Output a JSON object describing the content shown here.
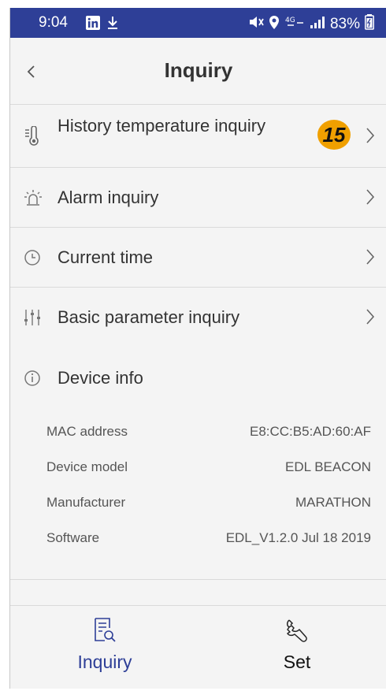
{
  "status_bar": {
    "time": "9:04",
    "battery": "83%",
    "network_tag": "4G",
    "background_color": "#2e3f97"
  },
  "header": {
    "title": "Inquiry",
    "back_icon": "chevron-left-icon"
  },
  "menu": {
    "items": [
      {
        "icon": "thermometer-icon",
        "label": "History temperature inquiry",
        "badge": "15"
      },
      {
        "icon": "alarm-icon",
        "label": "Alarm inquiry"
      },
      {
        "icon": "clock-icon",
        "label": "Current time"
      },
      {
        "icon": "sliders-icon",
        "label": "Basic parameter inquiry"
      }
    ]
  },
  "device_info": {
    "icon": "info-icon",
    "title": "Device info",
    "rows": [
      {
        "key": "MAC address",
        "value": "E8:CC:B5:AD:60:AF"
      },
      {
        "key": "Device model",
        "value": "EDL BEACON"
      },
      {
        "key": "Manufacturer",
        "value": "MARATHON"
      },
      {
        "key": "Software",
        "value": "EDL_V1.2.0 Jul 18 2019"
      }
    ]
  },
  "bottom_nav": {
    "items": [
      {
        "icon": "inquiry-document-icon",
        "label": "Inquiry",
        "active": true
      },
      {
        "icon": "wrench-icon",
        "label": "Set",
        "active": false
      }
    ],
    "active_color": "#2e3f97",
    "badge_color": "#f0a000"
  }
}
